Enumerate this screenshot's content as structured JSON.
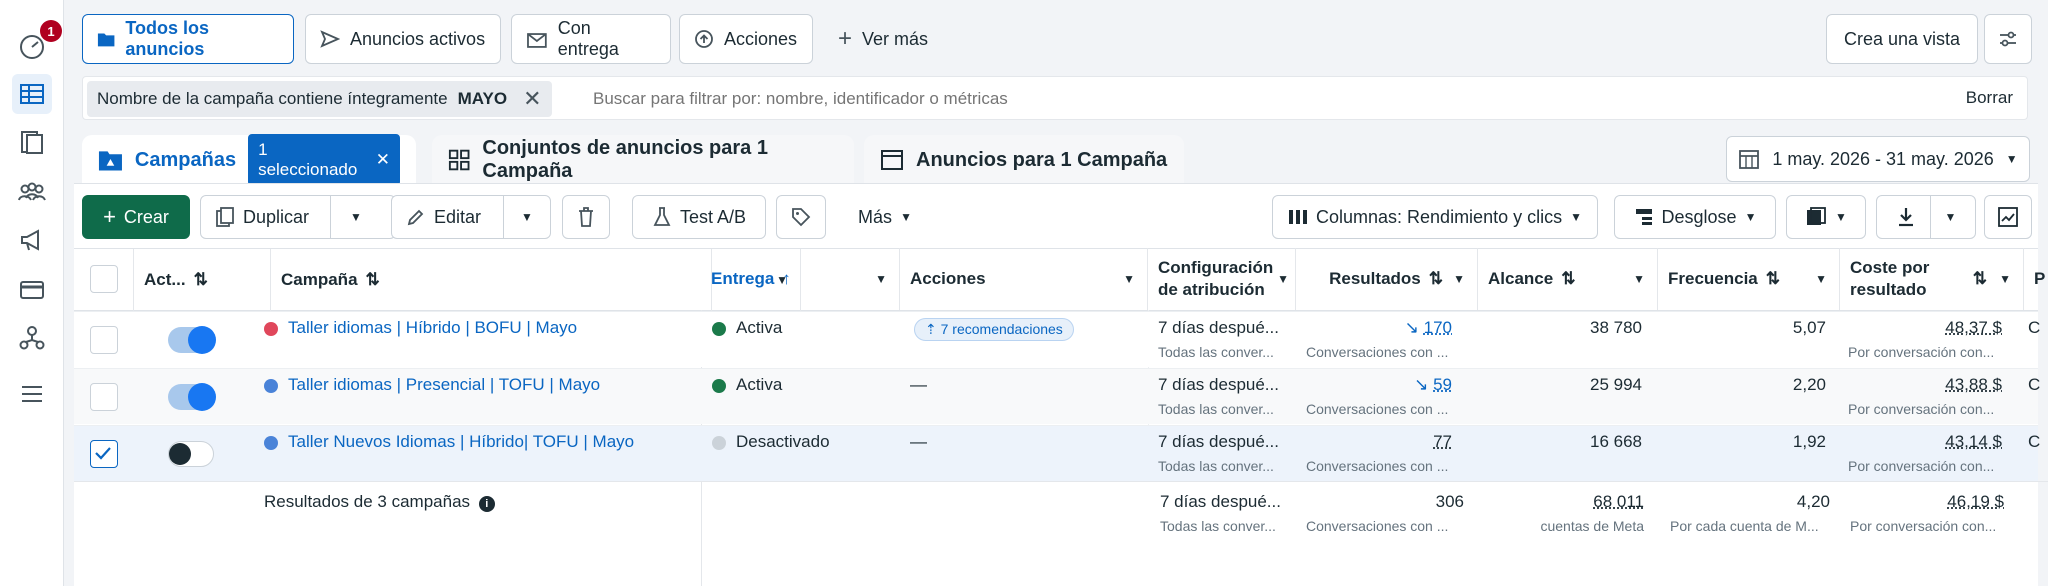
{
  "sidebar": {
    "notification_count": "1",
    "icons": [
      "speedometer-icon",
      "table-icon",
      "pages-icon",
      "audience-icon",
      "megaphone-icon",
      "credit-card-icon",
      "network-icon",
      "menu-icon"
    ]
  },
  "top_tabs": [
    {
      "label": "Todos los anuncios"
    },
    {
      "label": "Anuncios activos"
    },
    {
      "label": "Con entrega"
    },
    {
      "label": "Acciones"
    },
    {
      "label": "Ver más"
    }
  ],
  "create_view_label": "Crea una vista",
  "filter": {
    "chip_label": "Nombre de la campaña contiene íntegramente",
    "chip_value": "MAYO",
    "placeholder": "Buscar para filtrar por: nombre, identificador o métricas",
    "clear_label": "Borrar"
  },
  "level_tabs": {
    "campaigns": "Campañas",
    "selected_badge": "1 seleccionado",
    "adsets": "Conjuntos de anuncios para 1 Campaña",
    "ads": "Anuncios para 1 Campaña"
  },
  "date_range": "1 may. 2026 - 31 may. 2026",
  "toolbar": {
    "create": "Crear",
    "duplicate": "Duplicar",
    "edit": "Editar",
    "test_ab": "Test A/B",
    "more": "Más",
    "columns": "Columnas: Rendimiento y clics",
    "breakdown": "Desglose"
  },
  "columns": {
    "status": "Act...",
    "campaign": "Campaña",
    "delivery": "Entrega",
    "actions": "Acciones",
    "attribution": "Configuración de atribución",
    "results": "Resultados",
    "reach": "Alcance",
    "frequency": "Frecuencia",
    "cost": "Coste por resultado",
    "extra": "P"
  },
  "rows": [
    {
      "name": "Taller idiomas | Híbrido | BOFU | Mayo",
      "dot_color": "#e0475b",
      "toggle": "on",
      "checked": false,
      "delivery": "Activa",
      "delivery_color": "#1b7a4a",
      "actions": "7 recomendaciones",
      "attribution": "7 días despué...",
      "attribution_sub": "Todas las conver...",
      "results": "170",
      "results_sub": "Conversaciones con ...",
      "reach": "38 780",
      "frequency": "5,07",
      "cost": "48,37 $",
      "cost_sub": "Por conversación con...",
      "extra": "C"
    },
    {
      "name": "Taller idiomas | Presencial | TOFU | Mayo",
      "dot_color": "#4a83d8",
      "toggle": "on",
      "checked": false,
      "delivery": "Activa",
      "delivery_color": "#1b7a4a",
      "actions": "—",
      "attribution": "7 días despué...",
      "attribution_sub": "Todas las conver...",
      "results": "59",
      "results_sub": "Conversaciones con ...",
      "reach": "25 994",
      "frequency": "2,20",
      "cost": "43,88 $",
      "cost_sub": "Por conversación con...",
      "extra": "C"
    },
    {
      "name": "Taller Nuevos Idiomas | Híbrido| TOFU | Mayo",
      "dot_color": "#4a83d8",
      "toggle": "off",
      "checked": true,
      "delivery": "Desactivado",
      "delivery_color": "#cbd2d9",
      "actions": "—",
      "attribution": "7 días despué...",
      "attribution_sub": "Todas las conver...",
      "results": "77",
      "results_sub": "Conversaciones con ...",
      "reach": "16 668",
      "frequency": "1,92",
      "cost": "43,14 $",
      "cost_sub": "Por conversación con...",
      "extra": "C"
    }
  ],
  "summary": {
    "label": "Resultados de 3 campañas",
    "attribution": "7 días despué...",
    "attribution_sub": "Todas las conver...",
    "results": "306",
    "results_sub": "Conversaciones con ...",
    "reach": "68 011",
    "reach_sub": "cuentas de Meta",
    "frequency": "4,20",
    "frequency_sub": "Por cada cuenta de M...",
    "cost": "46,19 $",
    "cost_sub": "Por conversación con..."
  }
}
